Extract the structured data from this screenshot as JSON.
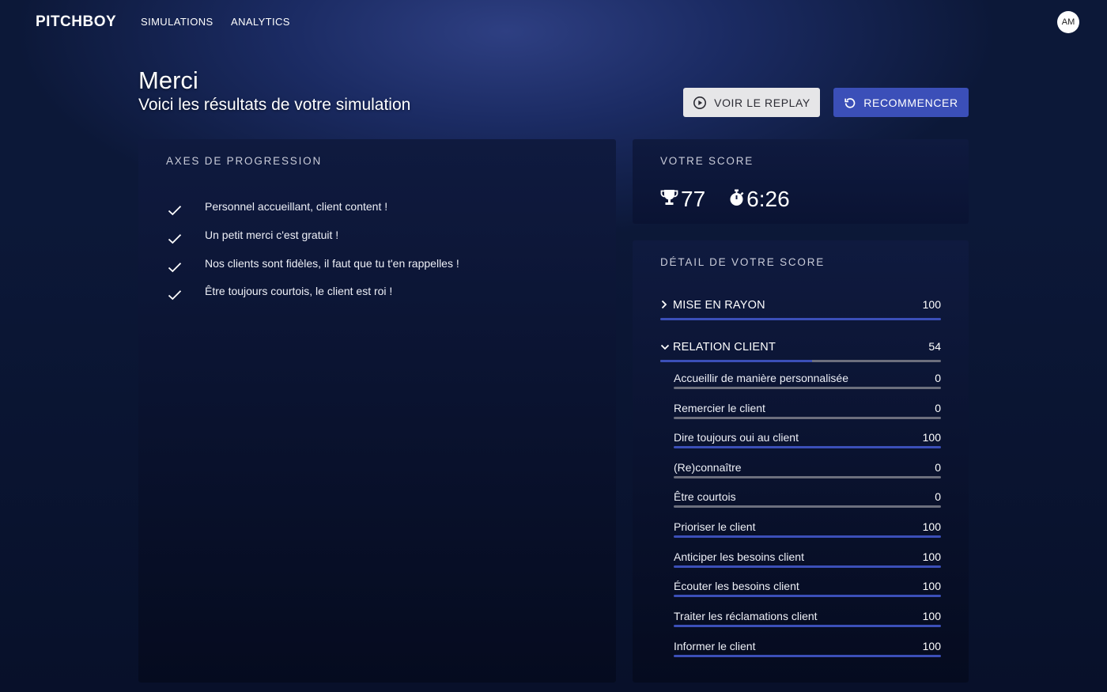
{
  "nav": {
    "logo": "PITCHBOY",
    "links": [
      "SIMULATIONS",
      "ANALYTICS"
    ],
    "avatar": "AM"
  },
  "header": {
    "title": "Merci",
    "subtitle": "Voici les résultats de votre simulation",
    "replay_label": "VOIR LE REPLAY",
    "restart_label": "RECOMMENCER"
  },
  "axes": {
    "heading": "AXES DE PROGRESSION",
    "items": [
      "Personnel accueillant, client content !",
      "Un petit merci c'est gratuit !",
      "Nos clients sont fidèles, il faut que tu t'en rappelles !",
      "Être toujours courtois, le client est roi !"
    ]
  },
  "score": {
    "heading": "VOTRE SCORE",
    "points": "77",
    "time": "6:26",
    "points_icon": "trophy-icon",
    "time_icon": "stopwatch-icon"
  },
  "detail": {
    "heading": "DÉTAIL DE VOTRE SCORE",
    "categories": [
      {
        "name": "MISE EN RAYON",
        "value": "100",
        "progress": 1.0,
        "expanded": false
      },
      {
        "name": "RELATION CLIENT",
        "value": "54",
        "progress": 0.54,
        "expanded": true
      }
    ],
    "subitems": [
      {
        "name": "Accueillir de manière personnalisée",
        "value": "0",
        "progress": 0
      },
      {
        "name": "Remercier le client",
        "value": "0",
        "progress": 0
      },
      {
        "name": "Dire toujours oui au client",
        "value": "100",
        "progress": 1
      },
      {
        "name": "(Re)connaître",
        "value": "0",
        "progress": 0
      },
      {
        "name": "Être courtois",
        "value": "0",
        "progress": 0
      },
      {
        "name": "Prioriser le client",
        "value": "100",
        "progress": 1
      },
      {
        "name": "Anticiper les besoins client",
        "value": "100",
        "progress": 1
      },
      {
        "name": "Écouter les besoins client",
        "value": "100",
        "progress": 1
      },
      {
        "name": "Traiter les réclamations client",
        "value": "100",
        "progress": 1
      },
      {
        "name": "Informer le client",
        "value": "100",
        "progress": 1
      }
    ]
  },
  "colors": {
    "accent": "#3b4fb8",
    "bar_track": "#6c6f7d",
    "background": "#0b1634"
  }
}
